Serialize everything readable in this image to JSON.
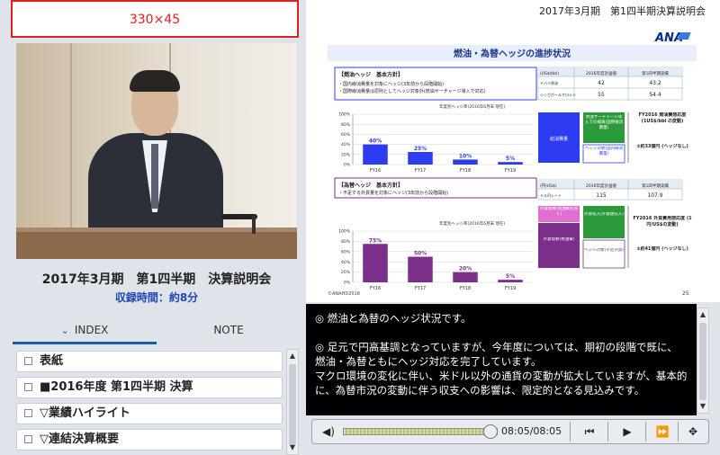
{
  "banner": {
    "text": "330×45"
  },
  "event": {
    "title": "2017年3月期　第1四半期　決算説明会",
    "record_time": "収録時間：約8分"
  },
  "tabs": [
    {
      "label": "INDEX"
    },
    {
      "label": "NOTE"
    }
  ],
  "index_items": [
    {
      "label": "表紙"
    },
    {
      "label": "■2016年度 第1四半期 決算"
    },
    {
      "label": "▽業績ハイライト"
    },
    {
      "label": "▽連結決算概要"
    }
  ],
  "slide": {
    "header": "2017年3月期　第1四半期決算説明会",
    "title": "燃油・為替ヘッジの進捗状況",
    "logo": "ANA",
    "page_no": "25",
    "copyright": "©ANAHD2016",
    "fuel": {
      "policy_title": "【燃油ヘッジ　基本方針】",
      "policy_lines": [
        "・国内線消費量を対象にヘッジ(3年前から段階開始)",
        "・国際線消費量は原則としてヘッジ対象外(燃油サーチャージ導入で対応)"
      ],
      "table_headers": [
        "(US$/bbl)",
        "2016年度計画値",
        "第1四半期実績"
      ],
      "table_rows": [
        [
          "ドバイ原油",
          "42",
          "43.2"
        ],
        [
          "シンガポールケロシン",
          "55",
          "54.4"
        ]
      ],
      "chart_caption": "年度別ヘッジ率(2016年6月末 現在)",
      "box_label": "総消費量",
      "box_right_top": "燃油サーチャージ収入での補填(国際線消費量)",
      "box_right_bottom": "ヘッジ対象(国内線消費量)",
      "sens_title": "FY2016 燃油費感応度 (1US$/bbl の変動)",
      "sens_value": "±約33億円 (ヘッジなし)"
    },
    "fx": {
      "policy_title": "【為替ヘッジ　基本方針】",
      "policy_lines": [
        "・不足する外貨量を対象にヘッジ(3年前から段階開始)"
      ],
      "table_headers": [
        "(円/US$)",
        "2016年度計画値",
        "第1四半期実績"
      ],
      "table_rows": [
        [
          "ドル円レート",
          "115",
          "107.9"
        ]
      ],
      "chart_caption": "年度別ヘッジ率(2016年6月末 現在)",
      "box_top": "外貨需要(燃油費を除く)",
      "box_bottom": "外貨需要(燃油費)",
      "box_right_top": "外貨収入(外貨建収入)",
      "box_right_bottom": "ヘッジ対象(不足外貨)",
      "sens_title": "FY2016 外貨費用感応度 (1円/US$の変動)",
      "sens_value": "±約41億円 (ヘッジなし)"
    }
  },
  "chart_data": [
    {
      "type": "bar",
      "categories": [
        "FY16",
        "FY17",
        "FY18",
        "FY19"
      ],
      "values": [
        40,
        25,
        10,
        5
      ],
      "value_labels": [
        "40%",
        "25%",
        "10%",
        "5%"
      ],
      "ylim": [
        0,
        100
      ],
      "yticks": [
        "100%",
        "80%",
        "60%",
        "40%",
        "20%",
        "0%"
      ],
      "color": "#2c3cf0"
    },
    {
      "type": "bar",
      "categories": [
        "FY16",
        "FY17",
        "FY18",
        "FY19"
      ],
      "values": [
        75,
        50,
        20,
        5
      ],
      "value_labels": [
        "75%",
        "50%",
        "20%",
        "5%"
      ],
      "ylim": [
        0,
        100
      ],
      "yticks": [
        "100%",
        "80%",
        "60%",
        "40%",
        "20%",
        "0%"
      ],
      "color": "#7a2f8a"
    }
  ],
  "transcript": {
    "lines": [
      "◎ 燃油と為替のヘッジ状況です。",
      "",
      "◎ 足元で円高基調となっていますが、今年度については、期初の段階で既に、燃油・為替ともにヘッジ対応を完了しています。",
      "マクロ環境の変化に伴い、米ドル以外の通貨の変動が拡大していますが、基本的に、為替市況の変動に伴う収支への影響は、限定的となる見込みです。"
    ]
  },
  "player": {
    "time": "08:05/08:05",
    "progress": 1.0
  }
}
